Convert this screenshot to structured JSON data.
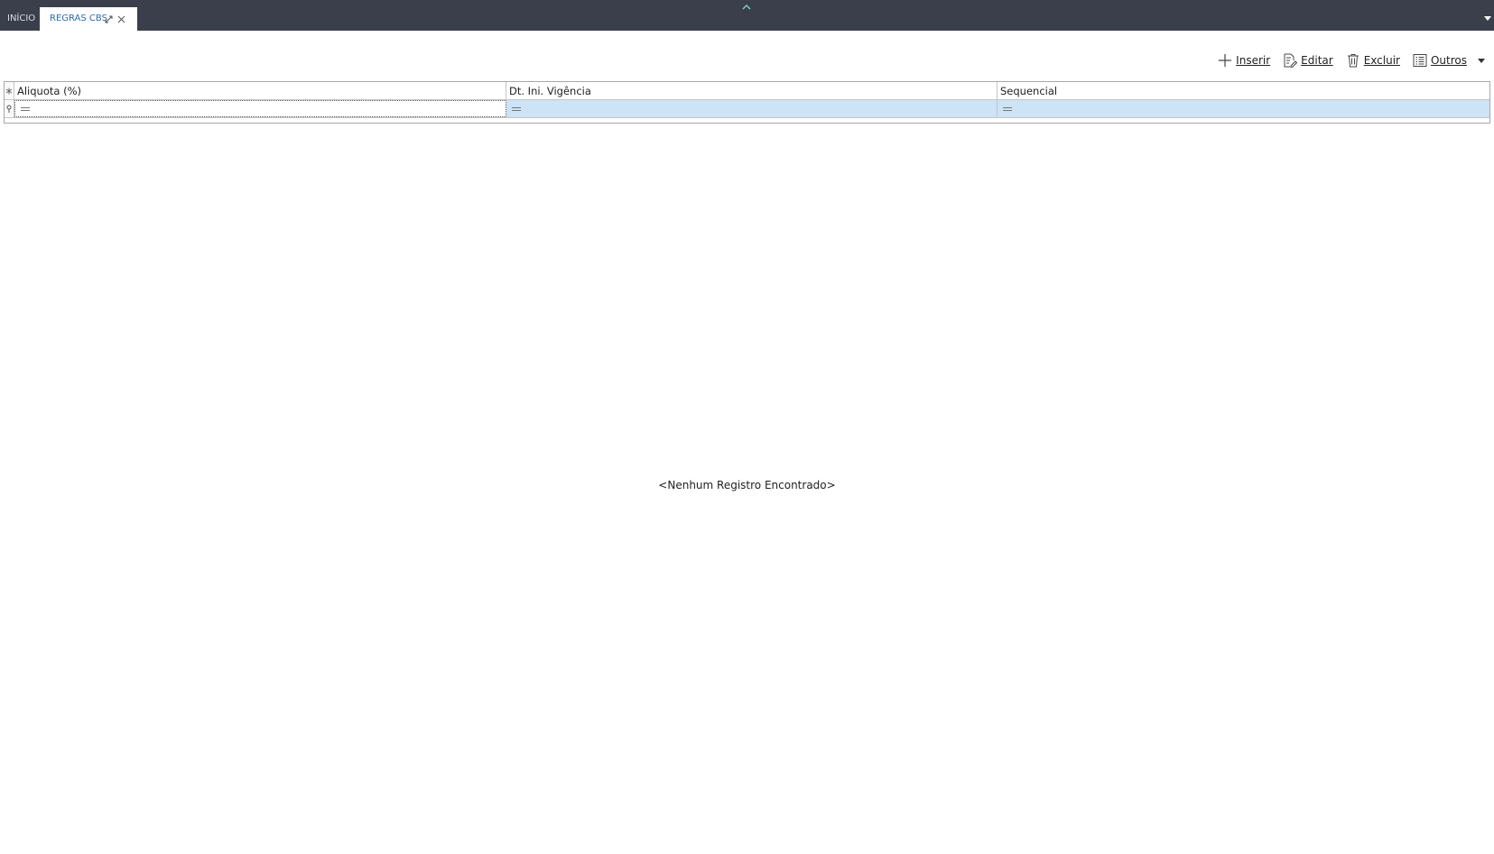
{
  "tabs": {
    "home_label": "INÍCIO",
    "active_label": "REGRAS CBS"
  },
  "toolbar": {
    "insert_label": "Inserir",
    "edit_label": "Editar",
    "delete_label": "Excluir",
    "others_label": "Outros"
  },
  "grid": {
    "columns": [
      "Aliquota (%)",
      "Dt. Ini. Vigência",
      "Sequencial"
    ],
    "rows": [],
    "empty_message": "<Nenhum Registro Encontrado>"
  },
  "colors": {
    "tabbar_bg": "#3a3f4b",
    "active_tab_text": "#2b6cb0",
    "selected_cell_bg": "#cde3f6"
  }
}
